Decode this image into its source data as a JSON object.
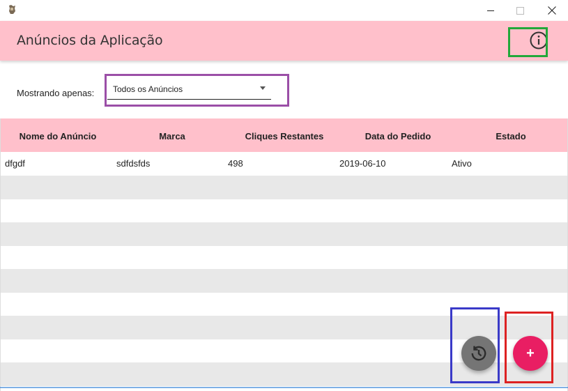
{
  "window": {
    "app_icon": "app-icon",
    "minimize_icon": "minimize-icon",
    "maximize_icon": "maximize-icon",
    "close_icon": "close-icon"
  },
  "header": {
    "title": "Anúncios da Aplicação",
    "info_icon": "info-icon",
    "background_color": "#ffc0cb"
  },
  "filter": {
    "label": "Mostrando apenas:",
    "selected": "Todos os Anúncios",
    "caret_icon": "caret-down-icon"
  },
  "table": {
    "columns": [
      "Nome do Anúncio",
      "Marca",
      "Cliques Restantes",
      "Data do Pedido",
      "Estado"
    ],
    "rows": [
      [
        "dfgdf",
        "sdfdsfds",
        "498",
        "2019-06-10",
        "Ativo"
      ]
    ]
  },
  "fabs": {
    "refresh_icon": "history-icon",
    "add_label": "+",
    "refresh_color": "#757575",
    "add_color": "#e91e63"
  },
  "highlights": {
    "green": "#22a83a",
    "purple": "#9b4fa7",
    "blue": "#3a3ac8",
    "red": "#dd2222"
  }
}
